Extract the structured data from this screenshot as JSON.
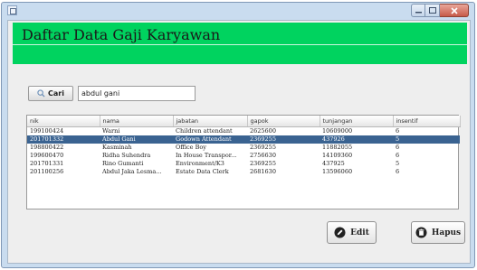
{
  "header": {
    "title": "Daftar Data Gaji Karyawan"
  },
  "search": {
    "button_label": "Cari",
    "button_icon": "search-icon",
    "query": "abdul gani"
  },
  "table": {
    "columns": [
      "nik",
      "nama",
      "jabatan",
      "gapok",
      "tunjangan",
      "insentif"
    ],
    "rows": [
      [
        "199100424",
        "Warni",
        "Children attendant",
        "2625600",
        "10609000",
        "6"
      ],
      [
        "201701332",
        "Abdul Gani",
        "Godown Attendant",
        "2369255",
        "437926",
        "5"
      ],
      [
        "198800422",
        "Kasminah",
        "Office Boy",
        "2369255",
        "11882055",
        "6"
      ],
      [
        "199600470",
        "Ridha Suhendra",
        "In House Transpor...",
        "2756630",
        "14109360",
        "6"
      ],
      [
        "201701331",
        "Rino Gumanti",
        "Environment/K3",
        "2369255",
        "437925",
        "5"
      ],
      [
        "201100256",
        "Abdul Jaka Lesma...",
        "Estate Data Clerk",
        "2681630",
        "13596060",
        "6"
      ]
    ],
    "selected_row": 1
  },
  "actions": {
    "edit_label": "Edit",
    "edit_icon": "edit-icon",
    "delete_label": "Hapus",
    "delete_icon": "delete-icon"
  },
  "colors": {
    "header_green": "#00d35f",
    "selected_row": "#3a6391",
    "close_button": "#c75a49"
  }
}
